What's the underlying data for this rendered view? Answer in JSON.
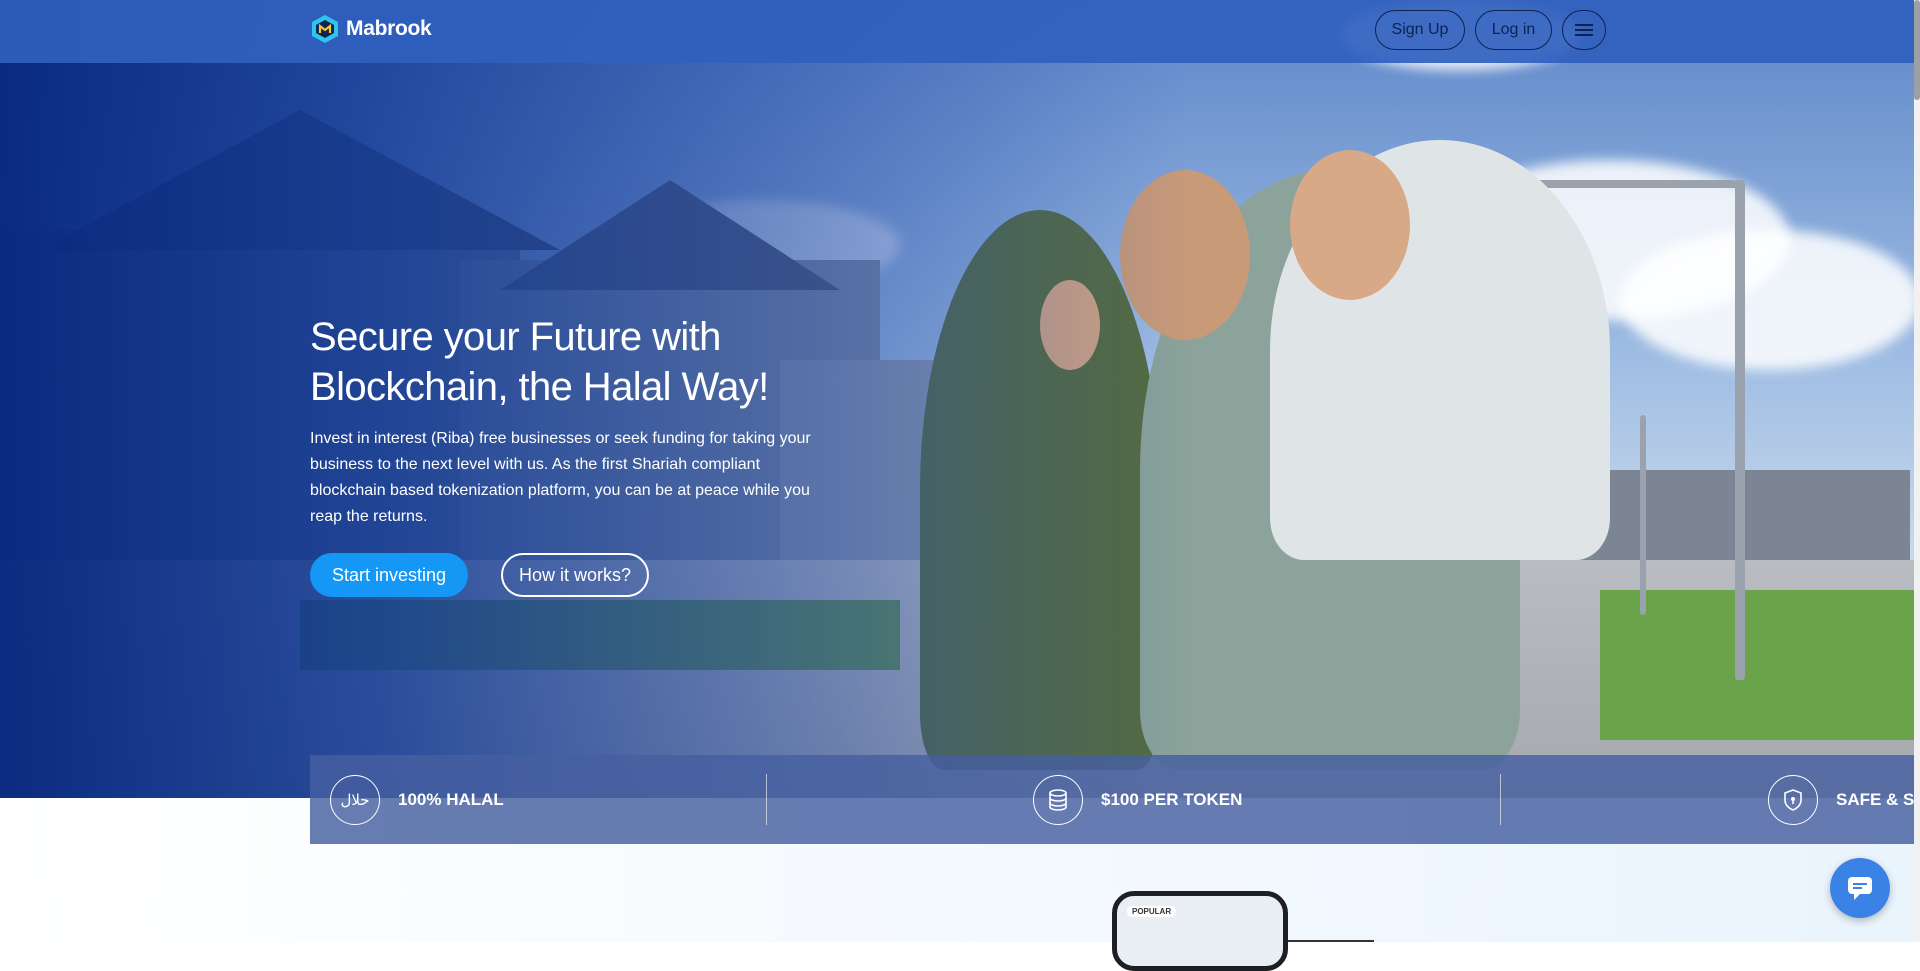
{
  "brand": {
    "name": "Mabrook",
    "logo_icon": "hexagon-m-logo-icon"
  },
  "nav": {
    "signup_label": "Sign Up",
    "login_label": "Log in",
    "menu_icon": "hamburger-icon"
  },
  "hero": {
    "title": "Secure your Future with Blockchain, the Halal Way!",
    "subtitle": "Invest in interest (Riba) free businesses or seek funding for taking your business to the next level with us. As the first Shariah compliant blockchain based tokenization platform, you can be at peace while you reap the returns.",
    "primary_cta": "Start investing",
    "secondary_cta": "How it works?"
  },
  "features": [
    {
      "label": "100% HALAL",
      "icon": "halal-icon",
      "icon_text": "حلال"
    },
    {
      "label": "$100 PER TOKEN",
      "icon": "coins-stack-icon"
    },
    {
      "label": "SAFE & SE",
      "icon": "shield-icon"
    }
  ],
  "preview": {
    "badge": "POPULAR"
  },
  "chat": {
    "icon": "chat-bubble-icon"
  },
  "colors": {
    "nav_bg": "#3060BE",
    "primary_button": "#1497F5",
    "overlay_blue": "#082880",
    "chat_button": "#3B82E6"
  }
}
